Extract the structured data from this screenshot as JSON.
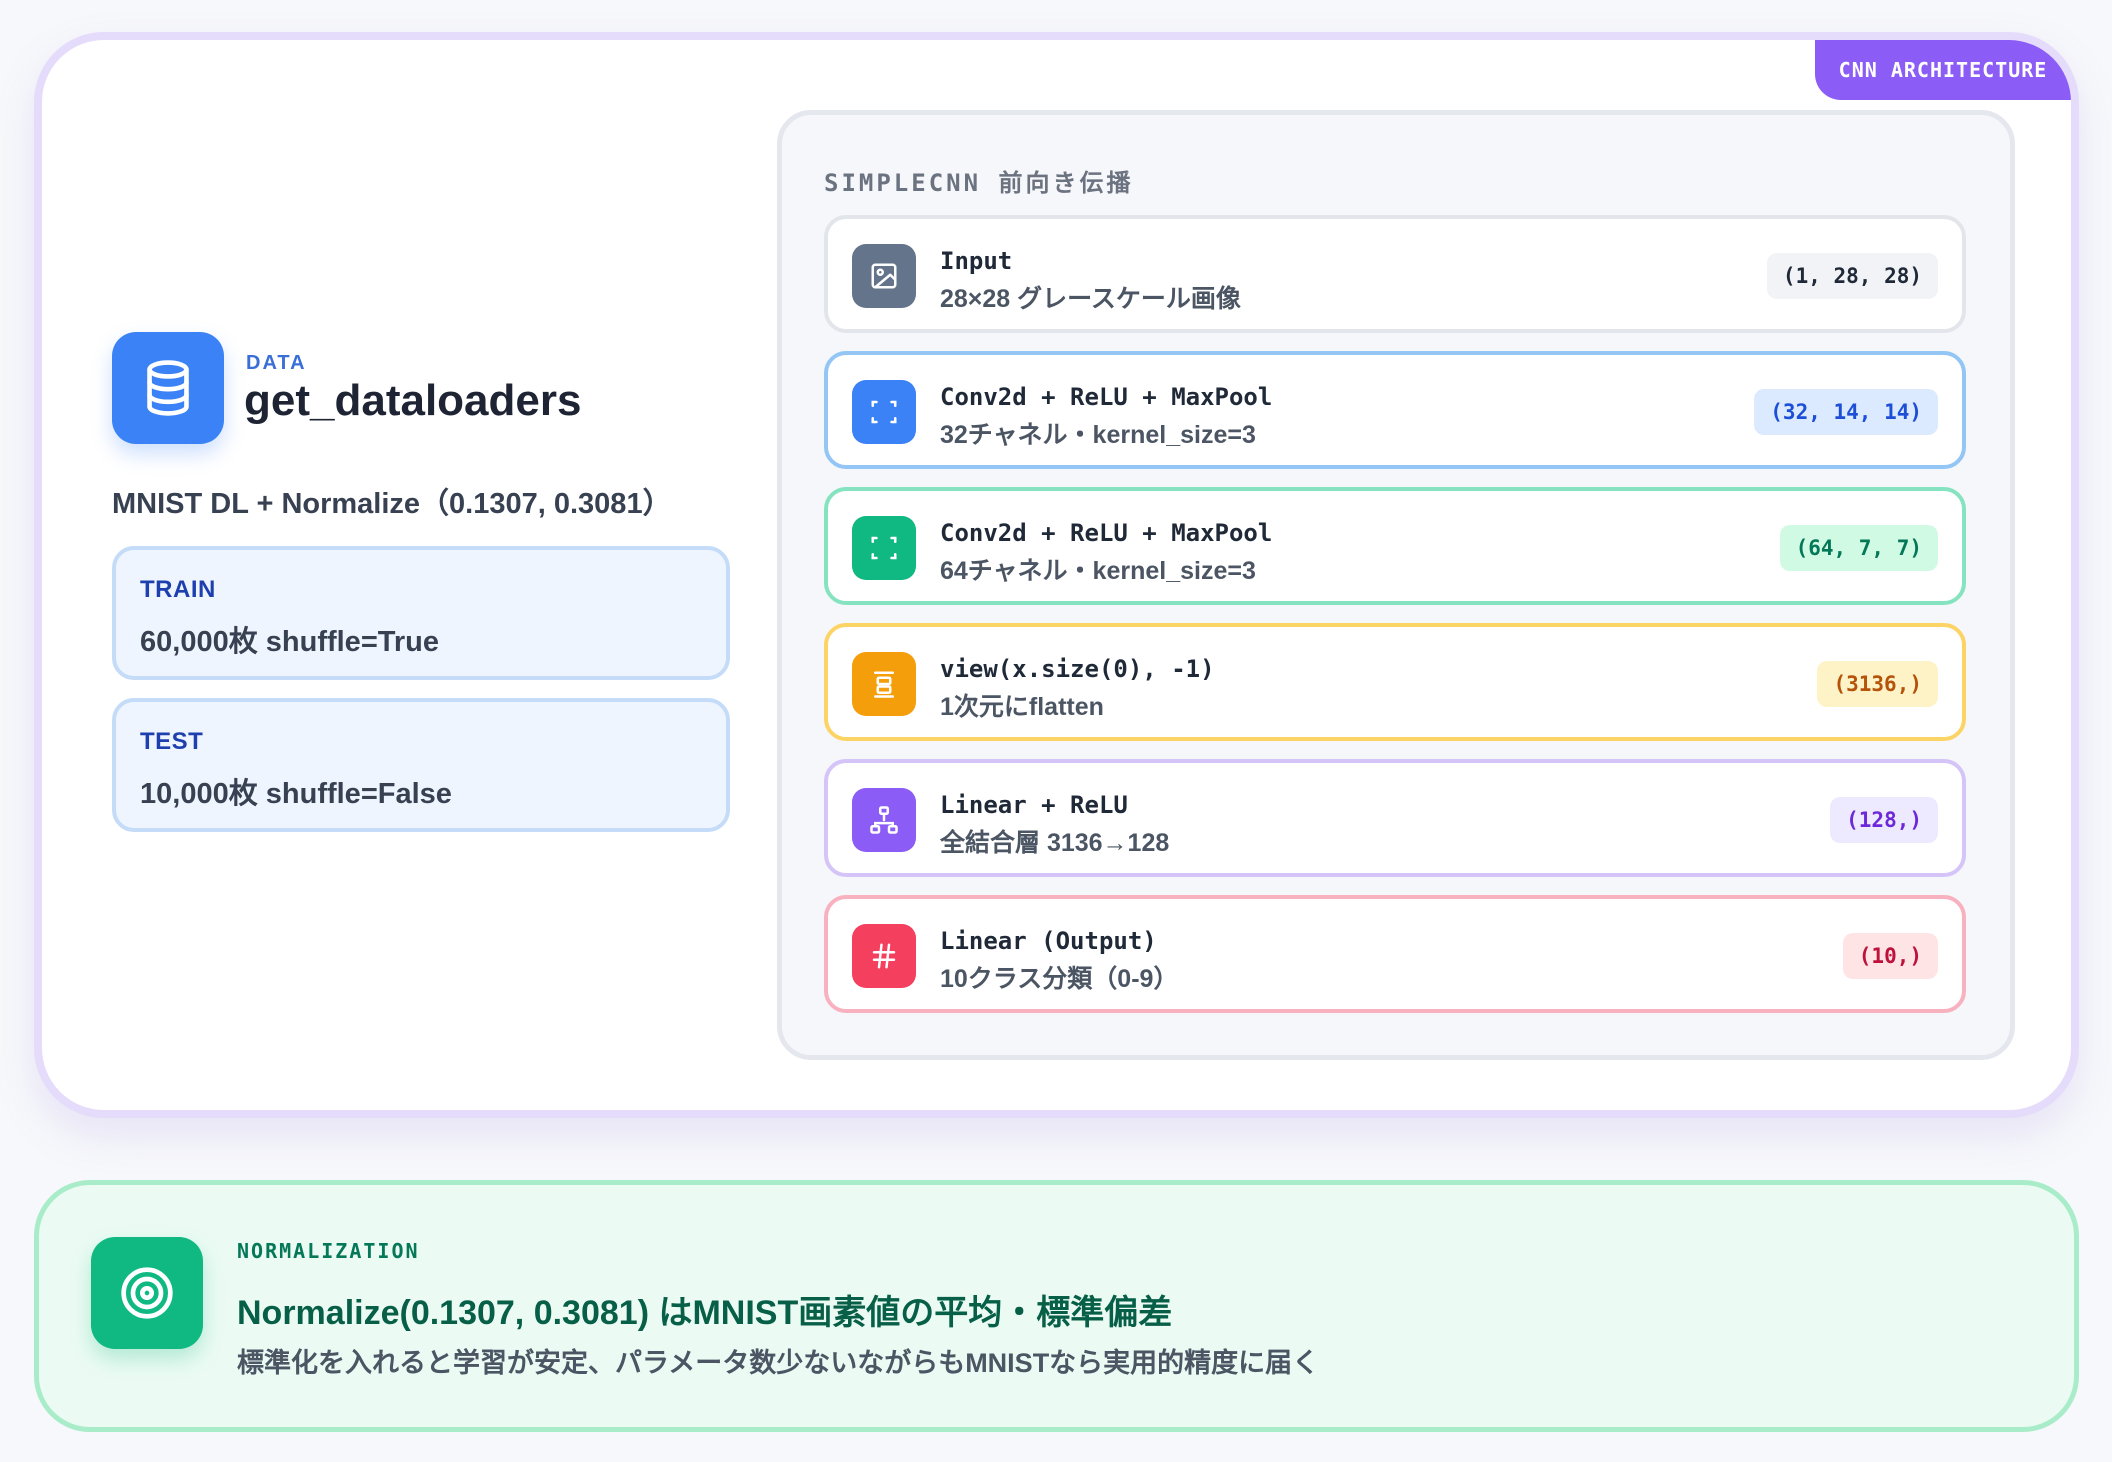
{
  "badge": "CNN ARCHITECTURE",
  "data_section": {
    "kicker": "DATA",
    "title": "get_dataloaders",
    "subtitle": "MNIST DL + Normalize（0.1307, 0.3081）",
    "train": {
      "label": "TRAIN",
      "value": "60,000枚 shuffle=True"
    },
    "test": {
      "label": "TEST",
      "value": "10,000枚 shuffle=False"
    }
  },
  "flow": {
    "title": "SIMPLECNN 前向き伝播",
    "layers": [
      {
        "name": "Input",
        "desc": "28×28 グレースケール画像",
        "shape": "(1, 28, 28)",
        "icon": "image-icon",
        "color": "#64748b",
        "border": "#e2e5ea",
        "shape_bg": "#f1f3f6",
        "shape_fg": "#1f2937"
      },
      {
        "name": "Conv2d + ReLU + MaxPool",
        "desc": "32チャネル・kernel_size=3",
        "shape": "(32, 14, 14)",
        "icon": "scan-icon",
        "color": "#3b82f6",
        "border": "#93c5f5",
        "shape_bg": "#dbeafe",
        "shape_fg": "#1d4ed8"
      },
      {
        "name": "Conv2d + ReLU + MaxPool",
        "desc": "64チャネル・kernel_size=3",
        "shape": "(64, 7, 7)",
        "icon": "scan-icon",
        "color": "#10b981",
        "border": "#86e3c0",
        "shape_bg": "#d1fae5",
        "shape_fg": "#047857"
      },
      {
        "name": "view(x.size(0), -1)",
        "desc": "1次元にflatten",
        "shape": "(3136,)",
        "icon": "flatten-icon",
        "color": "#f59e0b",
        "border": "#fcd466",
        "shape_bg": "#fef3c7",
        "shape_fg": "#b45309"
      },
      {
        "name": "Linear + ReLU",
        "desc": "全結合層 3136→128",
        "shape": "(128,)",
        "icon": "network-icon",
        "color": "#8b5cf6",
        "border": "#d4c4f8",
        "shape_bg": "#ede9fe",
        "shape_fg": "#6d28d9"
      },
      {
        "name": "Linear (Output)",
        "desc": "10クラス分類（0-9）",
        "shape": "(10,)",
        "icon": "hash-icon",
        "color": "#f43f5e",
        "border": "#f8b1bf",
        "shape_bg": "#ffe4e6",
        "shape_fg": "#be123c"
      }
    ]
  },
  "normalization": {
    "kicker": "NORMALIZATION",
    "title": "Normalize(0.1307, 0.3081) はMNIST画素値の平均・標準偏差",
    "desc": "標準化を入れると学習が安定、パラメータ数少ないながらもMNISTなら実用的精度に届く"
  }
}
